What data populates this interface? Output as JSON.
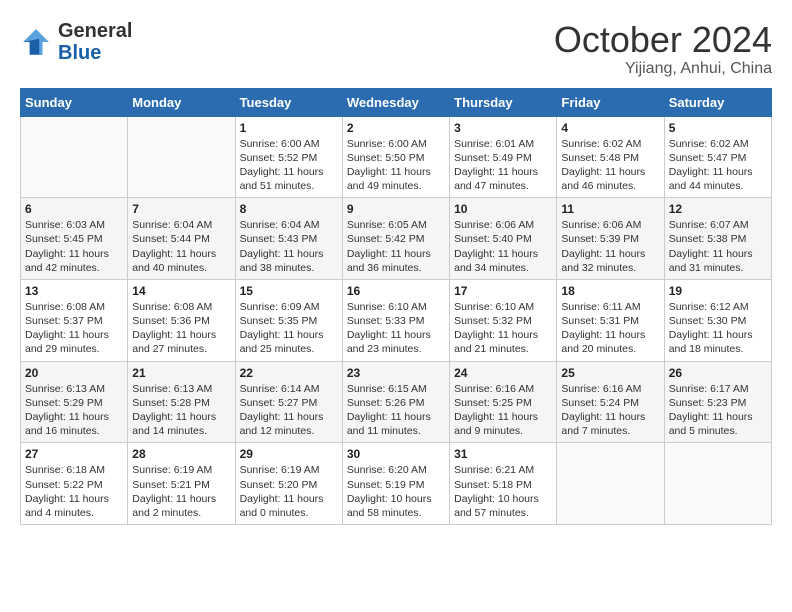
{
  "header": {
    "logo_general": "General",
    "logo_blue": "Blue",
    "month": "October 2024",
    "location": "Yijiang, Anhui, China"
  },
  "weekdays": [
    "Sunday",
    "Monday",
    "Tuesday",
    "Wednesday",
    "Thursday",
    "Friday",
    "Saturday"
  ],
  "weeks": [
    [
      {
        "day": "",
        "info": ""
      },
      {
        "day": "",
        "info": ""
      },
      {
        "day": "1",
        "info": "Sunrise: 6:00 AM\nSunset: 5:52 PM\nDaylight: 11 hours and 51 minutes."
      },
      {
        "day": "2",
        "info": "Sunrise: 6:00 AM\nSunset: 5:50 PM\nDaylight: 11 hours and 49 minutes."
      },
      {
        "day": "3",
        "info": "Sunrise: 6:01 AM\nSunset: 5:49 PM\nDaylight: 11 hours and 47 minutes."
      },
      {
        "day": "4",
        "info": "Sunrise: 6:02 AM\nSunset: 5:48 PM\nDaylight: 11 hours and 46 minutes."
      },
      {
        "day": "5",
        "info": "Sunrise: 6:02 AM\nSunset: 5:47 PM\nDaylight: 11 hours and 44 minutes."
      }
    ],
    [
      {
        "day": "6",
        "info": "Sunrise: 6:03 AM\nSunset: 5:45 PM\nDaylight: 11 hours and 42 minutes."
      },
      {
        "day": "7",
        "info": "Sunrise: 6:04 AM\nSunset: 5:44 PM\nDaylight: 11 hours and 40 minutes."
      },
      {
        "day": "8",
        "info": "Sunrise: 6:04 AM\nSunset: 5:43 PM\nDaylight: 11 hours and 38 minutes."
      },
      {
        "day": "9",
        "info": "Sunrise: 6:05 AM\nSunset: 5:42 PM\nDaylight: 11 hours and 36 minutes."
      },
      {
        "day": "10",
        "info": "Sunrise: 6:06 AM\nSunset: 5:40 PM\nDaylight: 11 hours and 34 minutes."
      },
      {
        "day": "11",
        "info": "Sunrise: 6:06 AM\nSunset: 5:39 PM\nDaylight: 11 hours and 32 minutes."
      },
      {
        "day": "12",
        "info": "Sunrise: 6:07 AM\nSunset: 5:38 PM\nDaylight: 11 hours and 31 minutes."
      }
    ],
    [
      {
        "day": "13",
        "info": "Sunrise: 6:08 AM\nSunset: 5:37 PM\nDaylight: 11 hours and 29 minutes."
      },
      {
        "day": "14",
        "info": "Sunrise: 6:08 AM\nSunset: 5:36 PM\nDaylight: 11 hours and 27 minutes."
      },
      {
        "day": "15",
        "info": "Sunrise: 6:09 AM\nSunset: 5:35 PM\nDaylight: 11 hours and 25 minutes."
      },
      {
        "day": "16",
        "info": "Sunrise: 6:10 AM\nSunset: 5:33 PM\nDaylight: 11 hours and 23 minutes."
      },
      {
        "day": "17",
        "info": "Sunrise: 6:10 AM\nSunset: 5:32 PM\nDaylight: 11 hours and 21 minutes."
      },
      {
        "day": "18",
        "info": "Sunrise: 6:11 AM\nSunset: 5:31 PM\nDaylight: 11 hours and 20 minutes."
      },
      {
        "day": "19",
        "info": "Sunrise: 6:12 AM\nSunset: 5:30 PM\nDaylight: 11 hours and 18 minutes."
      }
    ],
    [
      {
        "day": "20",
        "info": "Sunrise: 6:13 AM\nSunset: 5:29 PM\nDaylight: 11 hours and 16 minutes."
      },
      {
        "day": "21",
        "info": "Sunrise: 6:13 AM\nSunset: 5:28 PM\nDaylight: 11 hours and 14 minutes."
      },
      {
        "day": "22",
        "info": "Sunrise: 6:14 AM\nSunset: 5:27 PM\nDaylight: 11 hours and 12 minutes."
      },
      {
        "day": "23",
        "info": "Sunrise: 6:15 AM\nSunset: 5:26 PM\nDaylight: 11 hours and 11 minutes."
      },
      {
        "day": "24",
        "info": "Sunrise: 6:16 AM\nSunset: 5:25 PM\nDaylight: 11 hours and 9 minutes."
      },
      {
        "day": "25",
        "info": "Sunrise: 6:16 AM\nSunset: 5:24 PM\nDaylight: 11 hours and 7 minutes."
      },
      {
        "day": "26",
        "info": "Sunrise: 6:17 AM\nSunset: 5:23 PM\nDaylight: 11 hours and 5 minutes."
      }
    ],
    [
      {
        "day": "27",
        "info": "Sunrise: 6:18 AM\nSunset: 5:22 PM\nDaylight: 11 hours and 4 minutes."
      },
      {
        "day": "28",
        "info": "Sunrise: 6:19 AM\nSunset: 5:21 PM\nDaylight: 11 hours and 2 minutes."
      },
      {
        "day": "29",
        "info": "Sunrise: 6:19 AM\nSunset: 5:20 PM\nDaylight: 11 hours and 0 minutes."
      },
      {
        "day": "30",
        "info": "Sunrise: 6:20 AM\nSunset: 5:19 PM\nDaylight: 10 hours and 58 minutes."
      },
      {
        "day": "31",
        "info": "Sunrise: 6:21 AM\nSunset: 5:18 PM\nDaylight: 10 hours and 57 minutes."
      },
      {
        "day": "",
        "info": ""
      },
      {
        "day": "",
        "info": ""
      }
    ]
  ]
}
